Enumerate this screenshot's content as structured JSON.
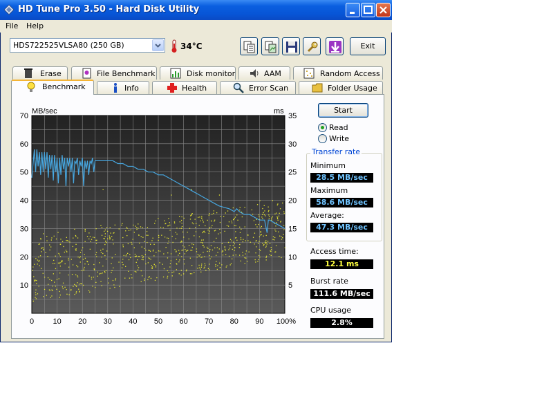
{
  "window": {
    "title": "HD Tune Pro 3.50 - Hard Disk Utility"
  },
  "menu": {
    "file": "File",
    "help": "Help"
  },
  "toolbar": {
    "drive": "HDS722525VLSA80 (250 GB)",
    "temperature": "34°C",
    "exit_label": "Exit"
  },
  "tabs": {
    "row1": [
      {
        "label": "Erase",
        "icon": "trash-icon"
      },
      {
        "label": "File Benchmark",
        "icon": "file-benchmark-icon"
      },
      {
        "label": "Disk monitor",
        "icon": "disk-monitor-icon"
      },
      {
        "label": "AAM",
        "icon": "speaker-icon"
      },
      {
        "label": "Random Access",
        "icon": "random-access-icon"
      }
    ],
    "row2": [
      {
        "label": "Benchmark",
        "icon": "lightbulb-icon",
        "active": true
      },
      {
        "label": "Info",
        "icon": "info-icon"
      },
      {
        "label": "Health",
        "icon": "health-cross-icon"
      },
      {
        "label": "Error Scan",
        "icon": "magnifier-icon"
      },
      {
        "label": "Folder Usage",
        "icon": "folder-icon"
      }
    ]
  },
  "controls": {
    "start_label": "Start",
    "read_label": "Read",
    "write_label": "Write",
    "selected_mode": "Read"
  },
  "stats": {
    "transfer_rate_title": "Transfer rate",
    "minimum_label": "Minimum",
    "minimum_value": "28.5 MB/sec",
    "maximum_label": "Maximum",
    "maximum_value": "58.6 MB/sec",
    "average_label": "Average:",
    "average_value": "47.3 MB/sec",
    "access_time_label": "Access time:",
    "access_time_value": "12.1 ms",
    "burst_rate_label": "Burst rate",
    "burst_rate_value": "111.6 MB/sec",
    "cpu_usage_label": "CPU usage",
    "cpu_usage_value": "2.8%"
  },
  "chart_data": {
    "type": "line",
    "ylabel_left": "MB/sec",
    "ylabel_right": "ms",
    "xlim": [
      0,
      100
    ],
    "ylim_left": [
      0,
      70
    ],
    "ylim_right": [
      0,
      35
    ],
    "x_ticks": [
      "0",
      "10",
      "20",
      "30",
      "40",
      "50",
      "60",
      "70",
      "80",
      "90",
      "100%"
    ],
    "y_ticks_left": [
      "10",
      "20",
      "30",
      "40",
      "50",
      "60",
      "70"
    ],
    "y_ticks_right": [
      "5",
      "10",
      "15",
      "20",
      "25",
      "30",
      "35"
    ],
    "grid": true,
    "colors": {
      "background": "#404040",
      "grid": "#8a8a8a",
      "transfer": "#47a7e0",
      "access": "#e6e62e"
    },
    "series": [
      {
        "axis": "left",
        "x": [
          0,
          1,
          1.5,
          2,
          2.5,
          3,
          3.5,
          4,
          4.5,
          5,
          5.5,
          6,
          6.5,
          7,
          7.5,
          8,
          8.5,
          9,
          9.5,
          10,
          10.5,
          11,
          11.5,
          12,
          12.5,
          13,
          13.5,
          14,
          14.5,
          15,
          15.5,
          16,
          16.5,
          17,
          17.5,
          18,
          18.5,
          19,
          19.5,
          20,
          20.5,
          21,
          21.5,
          22,
          22.5,
          23,
          23.5,
          24,
          24.5,
          25,
          26,
          28,
          30,
          32,
          34,
          36,
          38,
          40,
          42,
          44,
          46,
          48,
          50,
          52,
          54,
          56,
          58,
          60,
          62,
          64,
          66,
          68,
          70,
          72,
          74,
          76,
          78,
          80,
          81,
          82,
          84,
          86,
          88,
          90,
          92,
          93,
          93.5,
          94,
          96,
          98,
          100
        ],
        "y": [
          48,
          58,
          50,
          58,
          52,
          57,
          49,
          57,
          50,
          57,
          51,
          57,
          48,
          56,
          51,
          56,
          47,
          56,
          50,
          55,
          46,
          55,
          49,
          56,
          51,
          55,
          45,
          55,
          52,
          55,
          50,
          55,
          46,
          54,
          53,
          55,
          49,
          54,
          52,
          55,
          45,
          54,
          51,
          54,
          49,
          54,
          53,
          55,
          50,
          54,
          54,
          54,
          54,
          54,
          53,
          53,
          52,
          52,
          51,
          51,
          50,
          50,
          49,
          49,
          48,
          47,
          46,
          45,
          44,
          43,
          42,
          41,
          40,
          39,
          38,
          37.5,
          37,
          36,
          37,
          36,
          35,
          35,
          34,
          33,
          33,
          28.5,
          33,
          33,
          32,
          31,
          30
        ]
      },
      {
        "axis": "right",
        "type": "scatter",
        "y_range_start": [
          2,
          14
        ],
        "y_range_end": [
          10,
          20
        ],
        "approx_points": 800
      }
    ]
  }
}
